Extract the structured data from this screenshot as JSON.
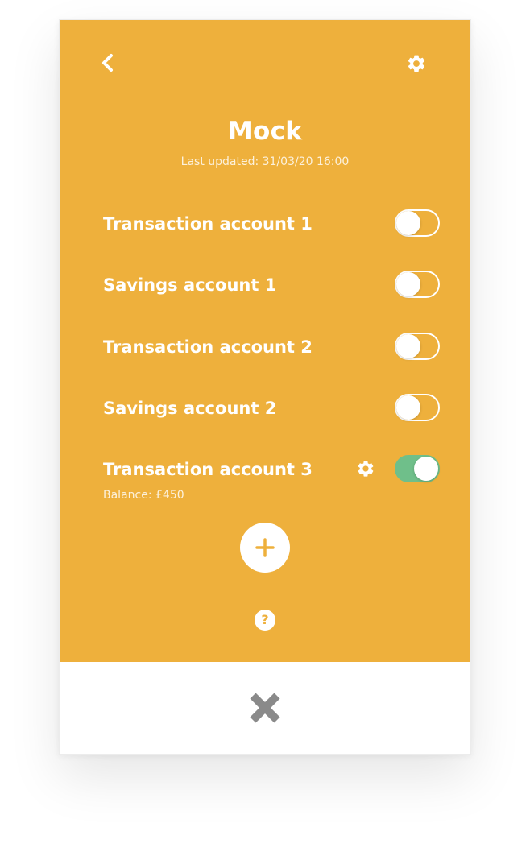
{
  "header": {
    "title": "Mock",
    "last_updated": "Last updated: 31/03/20 16:00",
    "back_icon": "chevron-left-icon",
    "settings_icon": "gear-icon"
  },
  "accounts": [
    {
      "name": "Transaction account 1",
      "enabled": false
    },
    {
      "name": "Savings account 1",
      "enabled": false
    },
    {
      "name": "Transaction account 2",
      "enabled": false
    },
    {
      "name": "Savings account 2",
      "enabled": false
    },
    {
      "name": "Transaction account 3",
      "enabled": true,
      "balance": "Balance: £450"
    }
  ],
  "actions": {
    "add_icon": "plus-icon",
    "help_glyph": "?",
    "close_icon": "close-icon"
  },
  "colors": {
    "panel": "#eeb03c",
    "toggle_on": "#6fbf8a",
    "close_icon": "#8a8a8a"
  }
}
